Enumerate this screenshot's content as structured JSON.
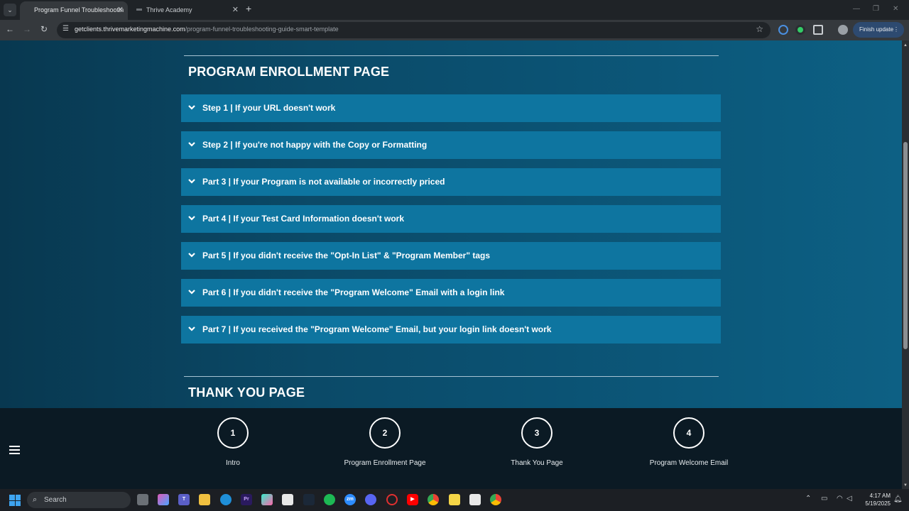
{
  "browser": {
    "tabs": [
      {
        "title": "Program Funnel Troubleshootin",
        "active": true
      },
      {
        "title": "Thrive Academy",
        "active": false
      }
    ],
    "url_host": "getclients.thrivemarketingmachine.com",
    "url_path": "/program-funnel-troubleshooting-guide-smart-template",
    "finish_update_label": "Finish update"
  },
  "page": {
    "enrollment_title": "PROGRAM ENROLLMENT PAGE",
    "accordion": [
      "Step 1 | If your URL doesn't work",
      "Step 2 | If you're not happy with the Copy or Formatting",
      "Part 3 | If your Program is not available or incorrectly priced",
      "Part 4 | If your Test Card Information doesn't work",
      "Part 5 | If you didn't receive the \"Opt-In List\" & \"Program Member\" tags",
      "Part 6 | If you didn't receive the \"Program Welcome\" Email with a login link",
      "Part 7 | If you received the \"Program Welcome\" Email, but your login link doesn't work"
    ],
    "thankyou_title": "THANK YOU PAGE"
  },
  "stepnav": {
    "steps": [
      {
        "number": "1",
        "label": "Intro"
      },
      {
        "number": "2",
        "label": "Program Enrollment Page"
      },
      {
        "number": "3",
        "label": "Thank You Page"
      },
      {
        "number": "4",
        "label": "Program Welcome Email"
      }
    ]
  },
  "taskbar": {
    "search_label": "Search",
    "time": "4:17 AM",
    "date": "5/19/2025"
  },
  "colors": {
    "accordion_bg": "#0e75a0",
    "page_gradient_start": "#083850",
    "page_gradient_end": "#0d6084",
    "stepnav_bg": "#0b1a24"
  }
}
